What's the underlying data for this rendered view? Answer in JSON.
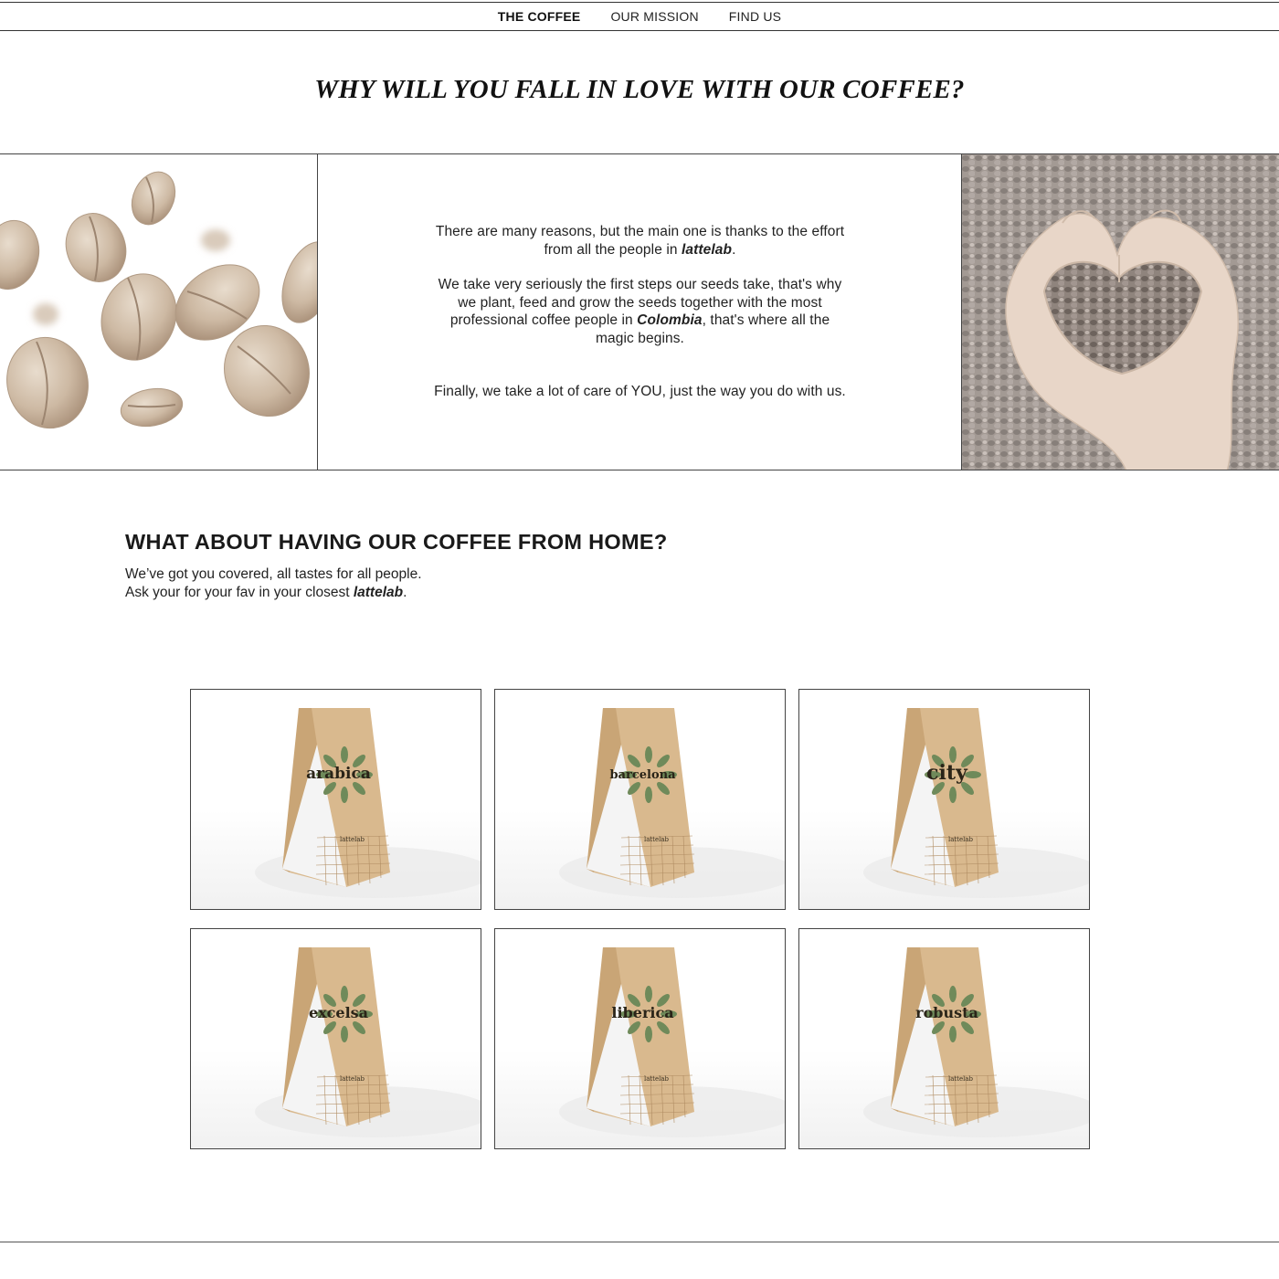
{
  "nav": {
    "items": [
      {
        "label": "THE COFFEE",
        "active": true
      },
      {
        "label": "OUR MISSION",
        "active": false
      },
      {
        "label": "FIND US",
        "active": false
      }
    ]
  },
  "hero": {
    "title": "WHY WILL YOU FALL IN LOVE WITH OUR COFFEE?"
  },
  "reasons": {
    "p1_before": "There are many reasons, but the main one is thanks to the effort from all the people in ",
    "p1_brand": "lattelab",
    "p1_after": ".",
    "p2_before": "We take very seriously the first steps our seeds take, that's why we plant, feed and grow the seeds together with the most professional coffee people in ",
    "p2_place": "Colombia",
    "p2_after": ", that's where all the magic begins.",
    "p3": "Finally, we take a lot of care of YOU, just the way you do with us."
  },
  "home": {
    "title": "WHAT ABOUT HAVING OUR COFFEE FROM HOME?",
    "line1": "We’ve got you covered, all tastes for all people.",
    "line2_before": "Ask your for your fav in your closest ",
    "line2_brand": "lattelab",
    "line2_after": "."
  },
  "products": [
    {
      "name": "arabica",
      "brand": "lattelab"
    },
    {
      "name": "barcelona",
      "brand": "lattelab"
    },
    {
      "name": "city",
      "brand": "lattelab"
    },
    {
      "name": "excelsa",
      "brand": "lattelab"
    },
    {
      "name": "liberica",
      "brand": "lattelab"
    },
    {
      "name": "robusta",
      "brand": "lattelab"
    }
  ],
  "colors": {
    "kraft": "#d9b98e",
    "kraft_shade": "#c9a576",
    "leaf": "#6f8a5a",
    "rule": "#444444"
  }
}
